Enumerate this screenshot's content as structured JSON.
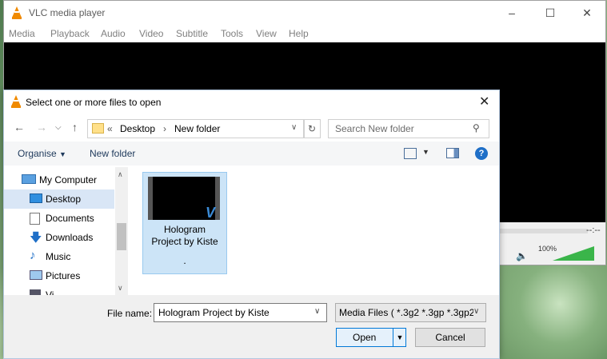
{
  "vlc": {
    "title": "VLC media player",
    "menu": [
      "Media",
      "Playback",
      "Audio",
      "Video",
      "Subtitle",
      "Tools",
      "View",
      "Help"
    ],
    "time": "--:--",
    "volume": "100%",
    "volume_level": 1.0
  },
  "dialog": {
    "title": "Select one or more files to open",
    "breadcrumb_prefix": "«",
    "breadcrumb": [
      "Desktop",
      "New folder"
    ],
    "search_placeholder": "Search New folder",
    "toolbar": {
      "organise": "Organise",
      "new_folder": "New folder",
      "help": "?"
    },
    "nav_items": [
      {
        "label": "My Computer",
        "icon": "computer-icon"
      },
      {
        "label": "Desktop",
        "icon": "desktop-icon",
        "selected": true
      },
      {
        "label": "Documents",
        "icon": "documents-icon"
      },
      {
        "label": "Downloads",
        "icon": "downloads-icon"
      },
      {
        "label": "Music",
        "icon": "music-icon"
      },
      {
        "label": "Pictures",
        "icon": "pictures-icon"
      },
      {
        "label": "Vi",
        "icon": "videos-icon"
      }
    ],
    "file": {
      "name_line1": "Hologram",
      "name_line2": "Project by Kiste",
      "name_line3": "."
    },
    "filename_label": "File name:",
    "filename_value": "Hologram Project by Kiste",
    "filetype_value": "Media Files ( *.3g2 *.3gp *.3gp2",
    "open_label": "Open",
    "cancel_label": "Cancel"
  }
}
